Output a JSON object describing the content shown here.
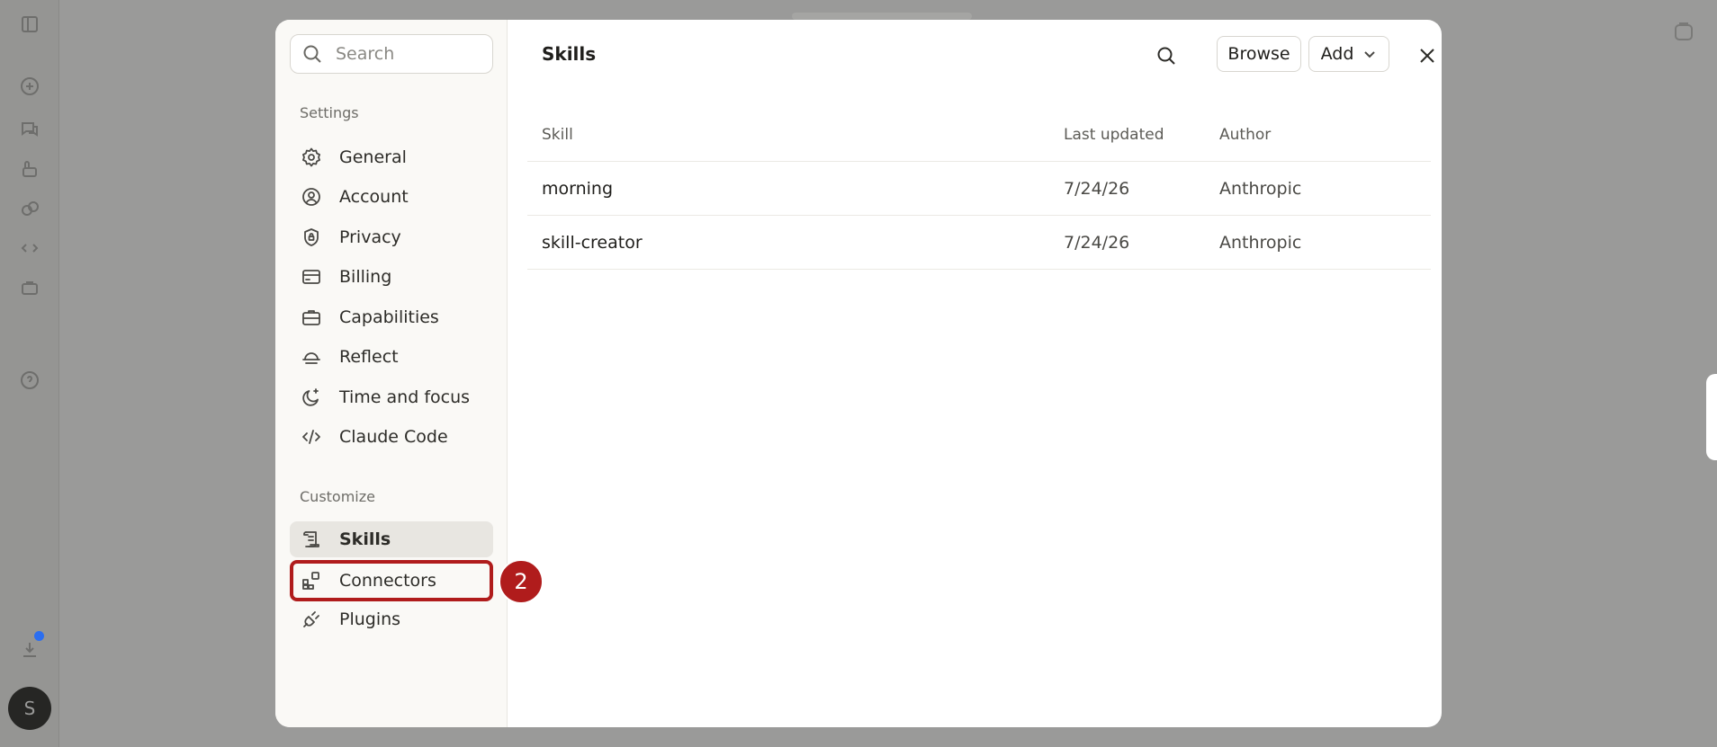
{
  "sidebar": {
    "search_placeholder": "Search",
    "settings_label": "Settings",
    "settings_items": [
      {
        "label": "General",
        "icon": "gear-icon"
      },
      {
        "label": "Account",
        "icon": "user-circle-icon"
      },
      {
        "label": "Privacy",
        "icon": "shield-lock-icon"
      },
      {
        "label": "Billing",
        "icon": "credit-card-icon"
      },
      {
        "label": "Capabilities",
        "icon": "briefcase-icon"
      },
      {
        "label": "Reflect",
        "icon": "reflect-icon"
      },
      {
        "label": "Time and focus",
        "icon": "moon-sparkle-icon"
      },
      {
        "label": "Claude Code",
        "icon": "code-icon"
      }
    ],
    "customize_label": "Customize",
    "customize_items": [
      {
        "label": "Skills",
        "icon": "scroll-icon",
        "active": true
      },
      {
        "label": "Connectors",
        "icon": "blocks-icon",
        "highlighted": true
      },
      {
        "label": "Plugins",
        "icon": "plug-icon"
      }
    ],
    "step_badge": "2"
  },
  "main": {
    "title": "Skills",
    "browse_label": "Browse",
    "add_label": "Add",
    "columns": [
      "Skill",
      "Last updated",
      "Author"
    ],
    "rows": [
      {
        "skill": "morning",
        "updated": "7/24/26",
        "author": "Anthropic"
      },
      {
        "skill": "skill-creator",
        "updated": "7/24/26",
        "author": "Anthropic"
      }
    ]
  },
  "background": {
    "avatar_initial": "S"
  },
  "colors": {
    "highlight": "#b01c1c",
    "active_bg": "#e8e6e1",
    "overlay": "#9a9a99"
  }
}
